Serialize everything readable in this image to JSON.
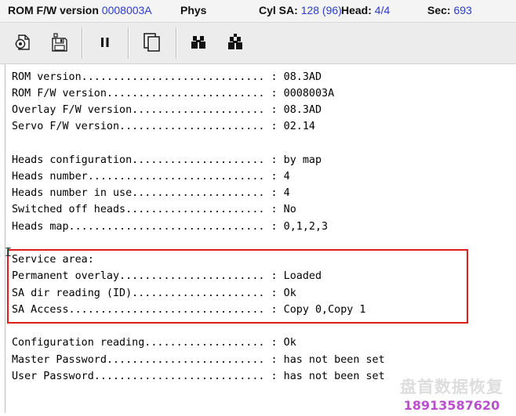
{
  "status": {
    "rom_fw_label": "ROM F/W version",
    "rom_fw_value": "0008003A",
    "mode": "Phys",
    "cyl_sa_label": "Cyl SA:",
    "cyl_sa_value": "128 (96)",
    "head_label": "Head:",
    "head_value": "4/4",
    "sec_label": "Sec:",
    "sec_value": "693"
  },
  "toolbar": {
    "icons": [
      "settings-chip-icon",
      "save-icon",
      "pause-icon",
      "copy-icon",
      "binoculars-icon",
      "binoculars-ext-icon"
    ]
  },
  "log": {
    "lines": [
      "ROM version............................. : 08.3AD",
      "ROM F/W version......................... : 0008003A",
      "Overlay F/W version..................... : 08.3AD",
      "Servo F/W version....................... : 02.14",
      "",
      "Heads configuration..................... : by map",
      "Heads number............................ : 4",
      "Heads number in use..................... : 4",
      "Switched off heads...................... : No",
      "Heads map............................... : 0,1,2,3",
      "",
      "Service area:",
      "Permanent overlay....................... : Loaded",
      "SA dir reading (ID)..................... : Ok",
      "SA Access............................... : Copy 0,Copy 1",
      "",
      "Configuration reading................... : Ok",
      "Master Password......................... : has not been set",
      "User Password........................... : has not been set"
    ]
  },
  "watermark": {
    "name": "盘首数据恢复",
    "phone": "18913587620"
  },
  "colors": {
    "status_value": "#2a3cd0",
    "highlight_box": "#e11d1d",
    "watermark_phone": "#b030c8"
  }
}
